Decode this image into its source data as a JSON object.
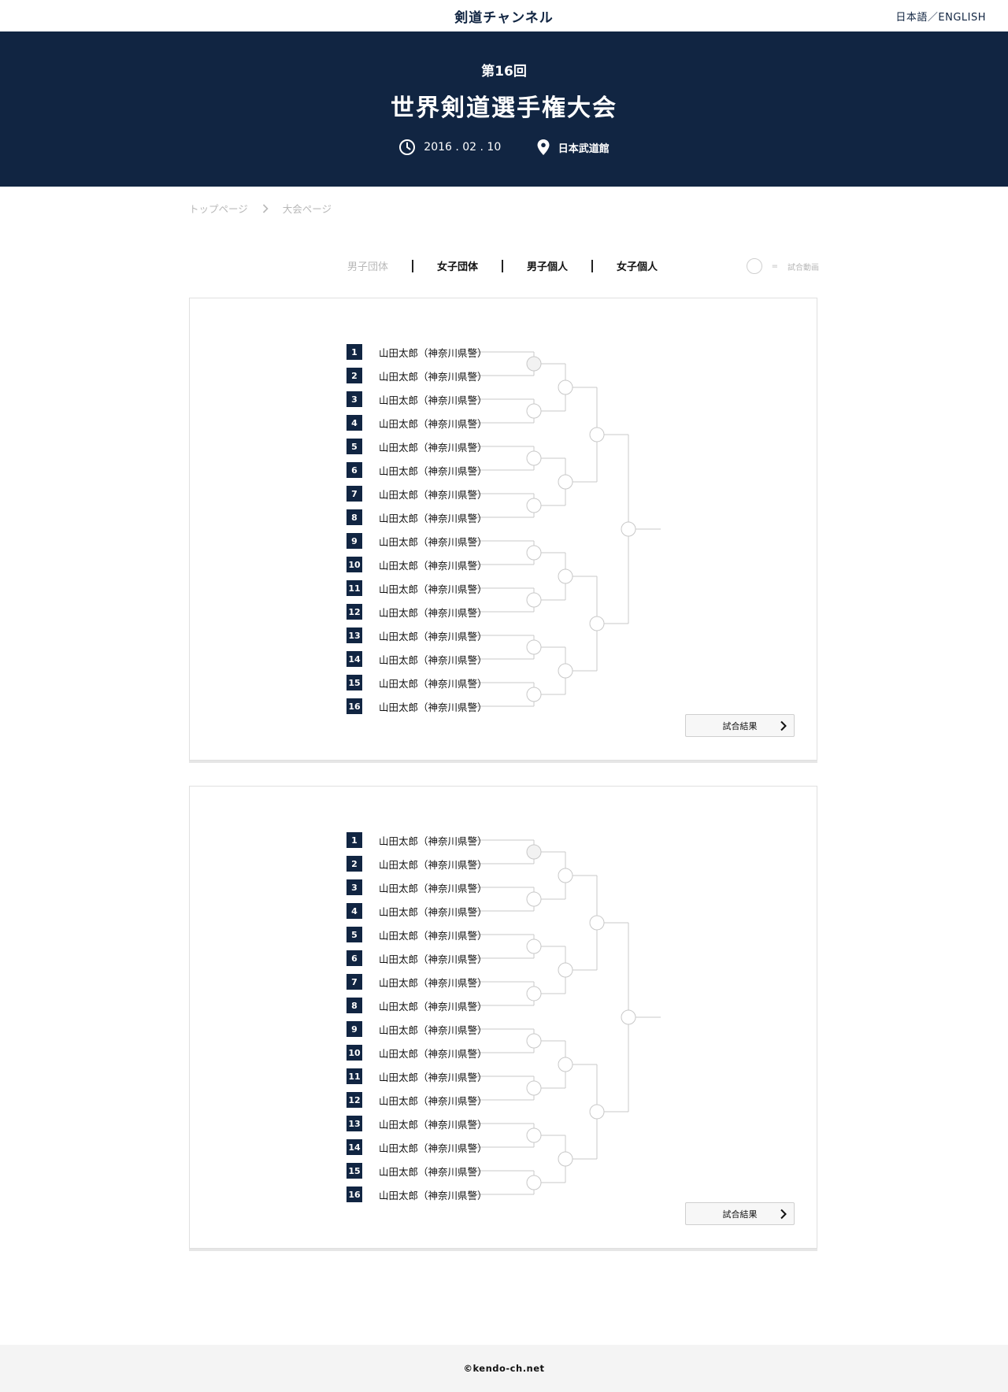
{
  "header": {
    "site_title": "剣道チャンネル",
    "language_switch": "日本語／ENGLISH"
  },
  "hero": {
    "edition": "第16回",
    "name": "世界剣道選手権大会",
    "date": "2016 . 02 . 10",
    "venue": "日本武道館",
    "icons": [
      "clock-icon",
      "location-pin-icon"
    ]
  },
  "breadcrumb": {
    "home": "トップページ",
    "current": "大会ページ"
  },
  "tabs": [
    {
      "label": "男子団体",
      "active": false
    },
    {
      "label": "女子団体",
      "active": true
    },
    {
      "label": "男子個人",
      "active": true
    },
    {
      "label": "女子個人",
      "active": true
    }
  ],
  "legend": {
    "equals": "=",
    "label": "試合動画"
  },
  "brackets": [
    {
      "entries": [
        {
          "seed": "1",
          "name": "山田太郎（神奈川県警）"
        },
        {
          "seed": "2",
          "name": "山田太郎（神奈川県警）"
        },
        {
          "seed": "3",
          "name": "山田太郎（神奈川県警）"
        },
        {
          "seed": "4",
          "name": "山田太郎（神奈川県警）"
        },
        {
          "seed": "5",
          "name": "山田太郎（神奈川県警）"
        },
        {
          "seed": "6",
          "name": "山田太郎（神奈川県警）"
        },
        {
          "seed": "7",
          "name": "山田太郎（神奈川県警）"
        },
        {
          "seed": "8",
          "name": "山田太郎（神奈川県警）"
        },
        {
          "seed": "9",
          "name": "山田太郎（神奈川県警）"
        },
        {
          "seed": "10",
          "name": "山田太郎（神奈川県警）"
        },
        {
          "seed": "11",
          "name": "山田太郎（神奈川県警）"
        },
        {
          "seed": "12",
          "name": "山田太郎（神奈川県警）"
        },
        {
          "seed": "13",
          "name": "山田太郎（神奈川県警）"
        },
        {
          "seed": "14",
          "name": "山田太郎（神奈川県警）"
        },
        {
          "seed": "15",
          "name": "山田太郎（神奈川県警）"
        },
        {
          "seed": "16",
          "name": "山田太郎（神奈川県警）"
        }
      ],
      "result_button": "試合結果"
    },
    {
      "entries": [
        {
          "seed": "1",
          "name": "山田太郎（神奈川県警）"
        },
        {
          "seed": "2",
          "name": "山田太郎（神奈川県警）"
        },
        {
          "seed": "3",
          "name": "山田太郎（神奈川県警）"
        },
        {
          "seed": "4",
          "name": "山田太郎（神奈川県警）"
        },
        {
          "seed": "5",
          "name": "山田太郎（神奈川県警）"
        },
        {
          "seed": "6",
          "name": "山田太郎（神奈川県警）"
        },
        {
          "seed": "7",
          "name": "山田太郎（神奈川県警）"
        },
        {
          "seed": "8",
          "name": "山田太郎（神奈川県警）"
        },
        {
          "seed": "9",
          "name": "山田太郎（神奈川県警）"
        },
        {
          "seed": "10",
          "name": "山田太郎（神奈川県警）"
        },
        {
          "seed": "11",
          "name": "山田太郎（神奈川県警）"
        },
        {
          "seed": "12",
          "name": "山田太郎（神奈川県警）"
        },
        {
          "seed": "13",
          "name": "山田太郎（神奈川県警）"
        },
        {
          "seed": "14",
          "name": "山田太郎（神奈川県警）"
        },
        {
          "seed": "15",
          "name": "山田太郎（神奈川県警）"
        },
        {
          "seed": "16",
          "name": "山田太郎（神奈川県警）"
        }
      ],
      "result_button": "試合結果"
    }
  ],
  "footer": {
    "copyright": "©kendo-ch.net"
  },
  "colors": {
    "navy": "#112542",
    "muted_text": "#b8b8b8",
    "bracket_line": "#c8c8c8",
    "footer_bg": "#f4f4f4"
  }
}
